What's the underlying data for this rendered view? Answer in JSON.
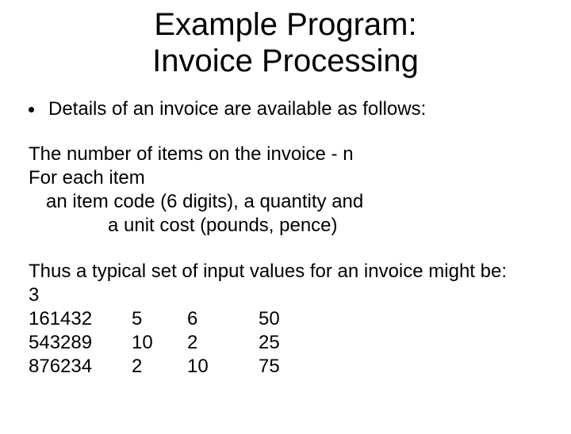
{
  "title_line1": "Example Program:",
  "title_line2": "Invoice Processing",
  "bullet_text": "Details of an invoice are available as follows:",
  "block1": {
    "line1": "The number of items on the invoice - n",
    "line2": "For each item",
    "line3": "an item code (6 digits), a quantity and",
    "line4": "a unit cost (pounds, pence)"
  },
  "block2": {
    "intro": "Thus a typical set of input values for an invoice might be:",
    "count": "3",
    "rows": [
      {
        "code": "161432",
        "qty": "5",
        "pounds": "6",
        "pence": "50"
      },
      {
        "code": "543289",
        "qty": "10",
        "pounds": "2",
        "pence": "25"
      },
      {
        "code": "876234",
        "qty": "2",
        "pounds": "10",
        "pence": "75"
      }
    ]
  }
}
